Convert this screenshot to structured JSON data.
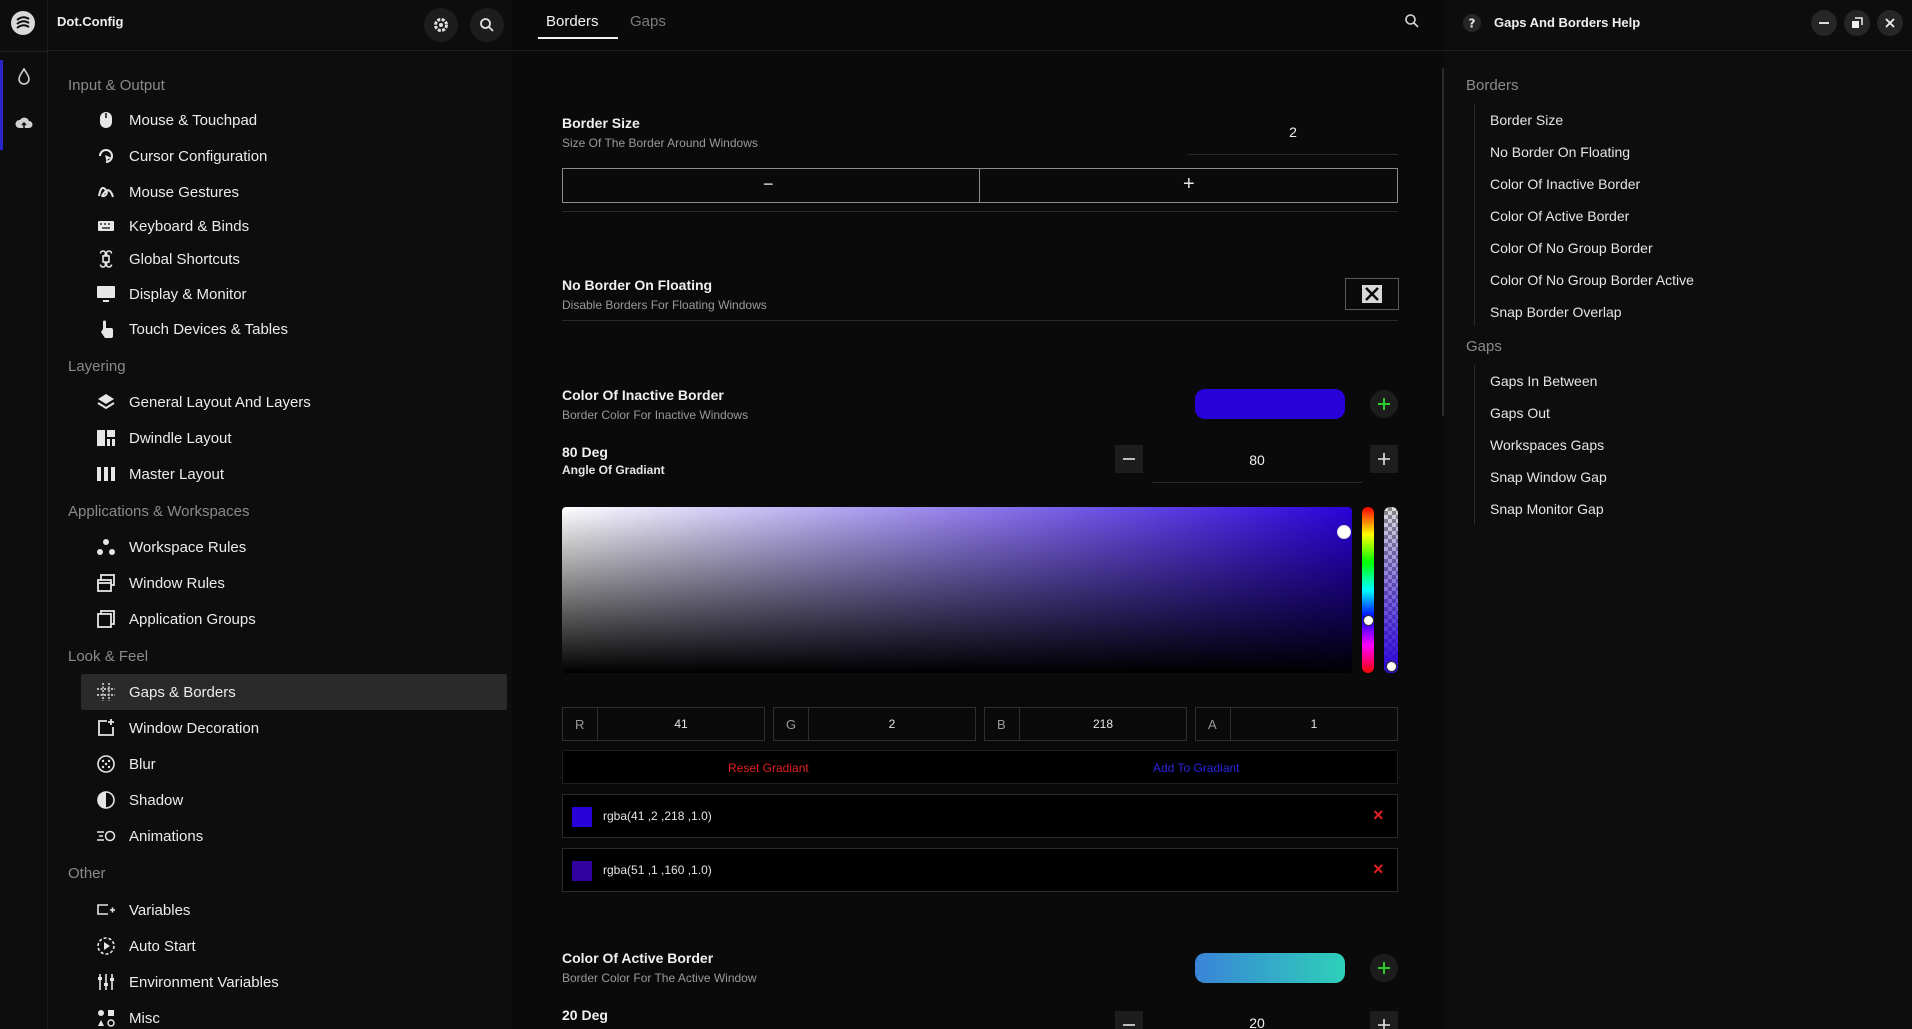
{
  "app": {
    "title": "Dot.Config"
  },
  "sidebar": {
    "sections": [
      {
        "label": "Input & Output",
        "items": [
          {
            "label": "Mouse & Touchpad",
            "icon": "mouse-icon"
          },
          {
            "label": "Cursor Configuration",
            "icon": "cursor-icon"
          },
          {
            "label": "Mouse Gestures",
            "icon": "gesture-icon"
          },
          {
            "label": "Keyboard & Binds",
            "icon": "keyboard-icon"
          },
          {
            "label": "Global Shortcuts",
            "icon": "command-icon"
          },
          {
            "label": "Display & Monitor",
            "icon": "monitor-icon"
          },
          {
            "label": "Touch Devices & Tables",
            "icon": "touch-icon"
          }
        ]
      },
      {
        "label": "Layering",
        "items": [
          {
            "label": "General Layout And Layers",
            "icon": "layers-icon"
          },
          {
            "label": "Dwindle Layout",
            "icon": "dwindle-icon"
          },
          {
            "label": "Master Layout",
            "icon": "columns-icon"
          }
        ]
      },
      {
        "label": "Applications & Workspaces",
        "items": [
          {
            "label": "Workspace Rules",
            "icon": "workspace-icon"
          },
          {
            "label": "Window Rules",
            "icon": "window-icon"
          },
          {
            "label": "Application Groups",
            "icon": "group-icon"
          }
        ]
      },
      {
        "label": "Look & Feel",
        "items": [
          {
            "label": "Gaps & Borders",
            "icon": "grid-icon"
          },
          {
            "label": "Window Decoration",
            "icon": "decoration-icon"
          },
          {
            "label": "Blur",
            "icon": "blur-icon"
          },
          {
            "label": "Shadow",
            "icon": "shadow-icon"
          },
          {
            "label": "Animations",
            "icon": "animation-icon"
          }
        ]
      },
      {
        "label": "Other",
        "items": [
          {
            "label": "Variables",
            "icon": "variables-icon"
          },
          {
            "label": "Auto Start",
            "icon": "autostart-icon"
          },
          {
            "label": "Environment Variables",
            "icon": "sliders-icon"
          },
          {
            "label": "Misc",
            "icon": "misc-icon"
          }
        ]
      }
    ],
    "active_item": "Gaps & Borders"
  },
  "tabs": [
    {
      "label": "Borders",
      "active": true
    },
    {
      "label": "Gaps",
      "active": false
    }
  ],
  "main": {
    "border_size": {
      "label": "Border Size",
      "desc": "Size Of The Border Around Windows",
      "value": "2",
      "minus": "−",
      "plus": "+"
    },
    "no_border_floating": {
      "label": "No Border On Floating",
      "desc": "Disable Borders For Floating Windows",
      "checked": false
    },
    "inactive_border": {
      "label": "Color Of Inactive Border",
      "desc": "Border Color For Inactive Windows",
      "swatch": "#2902da",
      "angle_label": "80 Deg",
      "angle_desc": "Angle Of Gradiant",
      "angle_value": "80",
      "rgba": {
        "r_key": "R",
        "r": "41",
        "g_key": "G",
        "g": "2",
        "b_key": "B",
        "b": "218",
        "a_key": "A",
        "a": "1"
      },
      "reset_label": "Reset Gradiant",
      "add_label": "Add To Gradiant",
      "stops": [
        {
          "text": "rgba(41 ,2 ,218 ,1.0)",
          "color": "#2902da"
        },
        {
          "text": "rgba(51 ,1 ,160 ,1.0)",
          "color": "#3301a0"
        }
      ]
    },
    "active_border": {
      "label": "Color Of Active Border",
      "desc": "Border Color For The Active Window",
      "swatch_from": "#3a84d8",
      "swatch_to": "#2ed0b8",
      "angle_label": "20 Deg",
      "angle_value": "20"
    }
  },
  "help": {
    "title": "Gaps And Borders Help",
    "sections": [
      {
        "label": "Borders",
        "items": [
          "Border Size",
          "No Border On Floating",
          "Color Of Inactive Border",
          "Color Of Active Border",
          "Color Of No Group Border",
          "Color Of No Group Border Active",
          "Snap Border Overlap"
        ]
      },
      {
        "label": "Gaps",
        "items": [
          "Gaps In Between",
          "Gaps Out",
          "Workspaces Gaps",
          "Snap Window Gap",
          "Snap Monitor Gap"
        ]
      }
    ]
  }
}
